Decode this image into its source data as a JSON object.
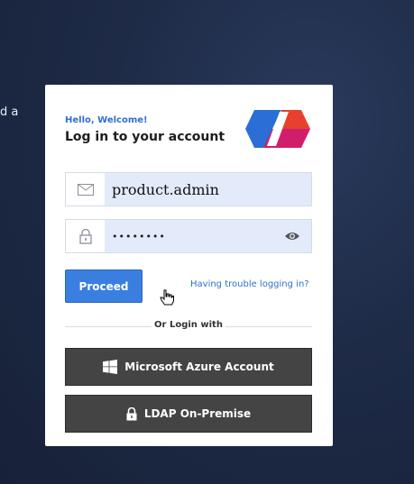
{
  "background": {
    "text_fragment": "d a"
  },
  "login": {
    "greeting": "Hello, Welcome!",
    "title": "Log in to your account",
    "username_value": "product.admin",
    "password_value": "••••••••",
    "proceed_label": "Proceed",
    "trouble_link": "Having trouble logging in?",
    "divider_text": "Or Login with",
    "azure_label": "Microsoft Azure Account",
    "ldap_label": "LDAP On-Premise"
  },
  "colors": {
    "accent": "#3a7fe0",
    "link": "#3070c8",
    "input_bg": "#e3ebfb",
    "sso_button": "#444444",
    "logo_blue": "#2b6fd6",
    "logo_red": "#e8402f",
    "logo_magenta": "#d21d6b"
  },
  "icons": [
    "logo-icon",
    "mail-icon",
    "lock-icon",
    "eye-icon",
    "windows-icon",
    "padlock-icon",
    "hand-cursor-icon"
  ]
}
